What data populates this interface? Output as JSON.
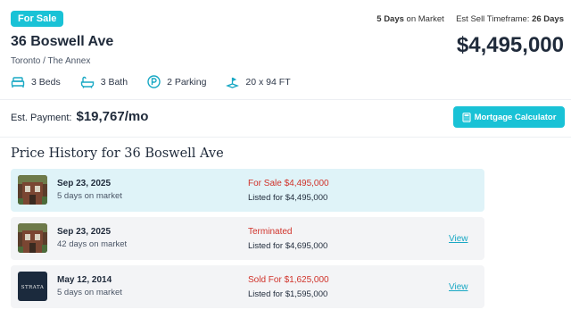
{
  "listing": {
    "status_badge": "For Sale",
    "days_on_market_value": "5 Days",
    "days_on_market_label": "on Market",
    "sell_timeframe_label": "Est Sell Timeframe:",
    "sell_timeframe_value": "26 Days",
    "address": "36 Boswell Ave",
    "locality": "Toronto / The Annex",
    "price": "$4,495,000",
    "features": {
      "beds": "3 Beds",
      "baths": "3 Bath",
      "parking": "2 Parking",
      "lot": "20 x 94 FT"
    },
    "est_payment_label": "Est. Payment:",
    "est_payment_value": "$19,767/mo",
    "mortgage_button": "Mortgage Calculator"
  },
  "price_history": {
    "title": "Price History for 36 Boswell Ave",
    "rows": [
      {
        "date": "Sep 23, 2025",
        "days": "5 days on market",
        "status": "For Sale $4,495,000",
        "listed": "Listed for $4,495,000",
        "view": "",
        "thumb": "house-photo"
      },
      {
        "date": "Sep 23, 2025",
        "days": "42 days on market",
        "status": "Terminated",
        "listed": "Listed for $4,695,000",
        "view": "View",
        "thumb": "house-photo"
      },
      {
        "date": "May 12, 2014",
        "days": "5 days on market",
        "status": "Sold For $1,625,000",
        "listed": "Listed for $1,595,000",
        "view": "View",
        "thumb": "strata-logo",
        "thumb_text": "STRATA"
      }
    ]
  },
  "colors": {
    "accent": "#19c2d6",
    "status_red": "#d0322a",
    "active_row": "#dff3f8",
    "row_bg": "#f3f4f6",
    "text_dark": "#1f2a3a"
  }
}
